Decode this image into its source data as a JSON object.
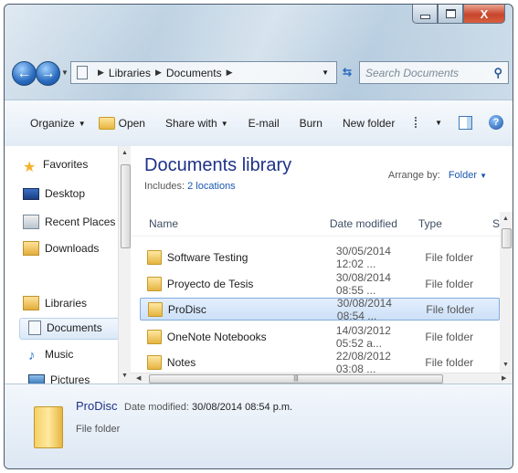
{
  "window": {
    "close_label": "X"
  },
  "address": {
    "crumbs": [
      "Libraries",
      "Documents"
    ],
    "search_placeholder": "Search Documents"
  },
  "toolbar": {
    "organize": "Organize",
    "open": "Open",
    "share_with": "Share with",
    "email": "E-mail",
    "burn": "Burn",
    "new_folder": "New folder"
  },
  "nav": {
    "favorites": "Favorites",
    "desktop": "Desktop",
    "recent_places": "Recent Places",
    "downloads": "Downloads",
    "libraries": "Libraries",
    "documents": "Documents",
    "music": "Music",
    "pictures": "Pictures"
  },
  "library": {
    "title": "Documents library",
    "includes_label": "Includes:",
    "includes_link": "2 locations",
    "arrange_label": "Arrange by:",
    "arrange_value": "Folder"
  },
  "columns": {
    "name": "Name",
    "date": "Date modified",
    "type": "Type",
    "size": "S"
  },
  "files": [
    {
      "name": "Software Testing",
      "date": "30/05/2014 12:02 ...",
      "type": "File folder"
    },
    {
      "name": "Proyecto de Tesis",
      "date": "30/08/2014 08:55 ...",
      "type": "File folder"
    },
    {
      "name": "ProDisc",
      "date": "30/08/2014 08:54 ...",
      "type": "File folder"
    },
    {
      "name": "OneNote Notebooks",
      "date": "14/03/2012 05:52 a...",
      "type": "File folder"
    },
    {
      "name": "Notes",
      "date": "22/08/2012 03:08 ...",
      "type": "File folder"
    }
  ],
  "details": {
    "name": "ProDisc",
    "date_label": "Date modified:",
    "date_value": "30/08/2014 08:54 p.m.",
    "type": "File folder"
  },
  "colors": {
    "title_blue": "#1e3287",
    "link_blue": "#1a57b0",
    "selection": "#cde0f7"
  }
}
